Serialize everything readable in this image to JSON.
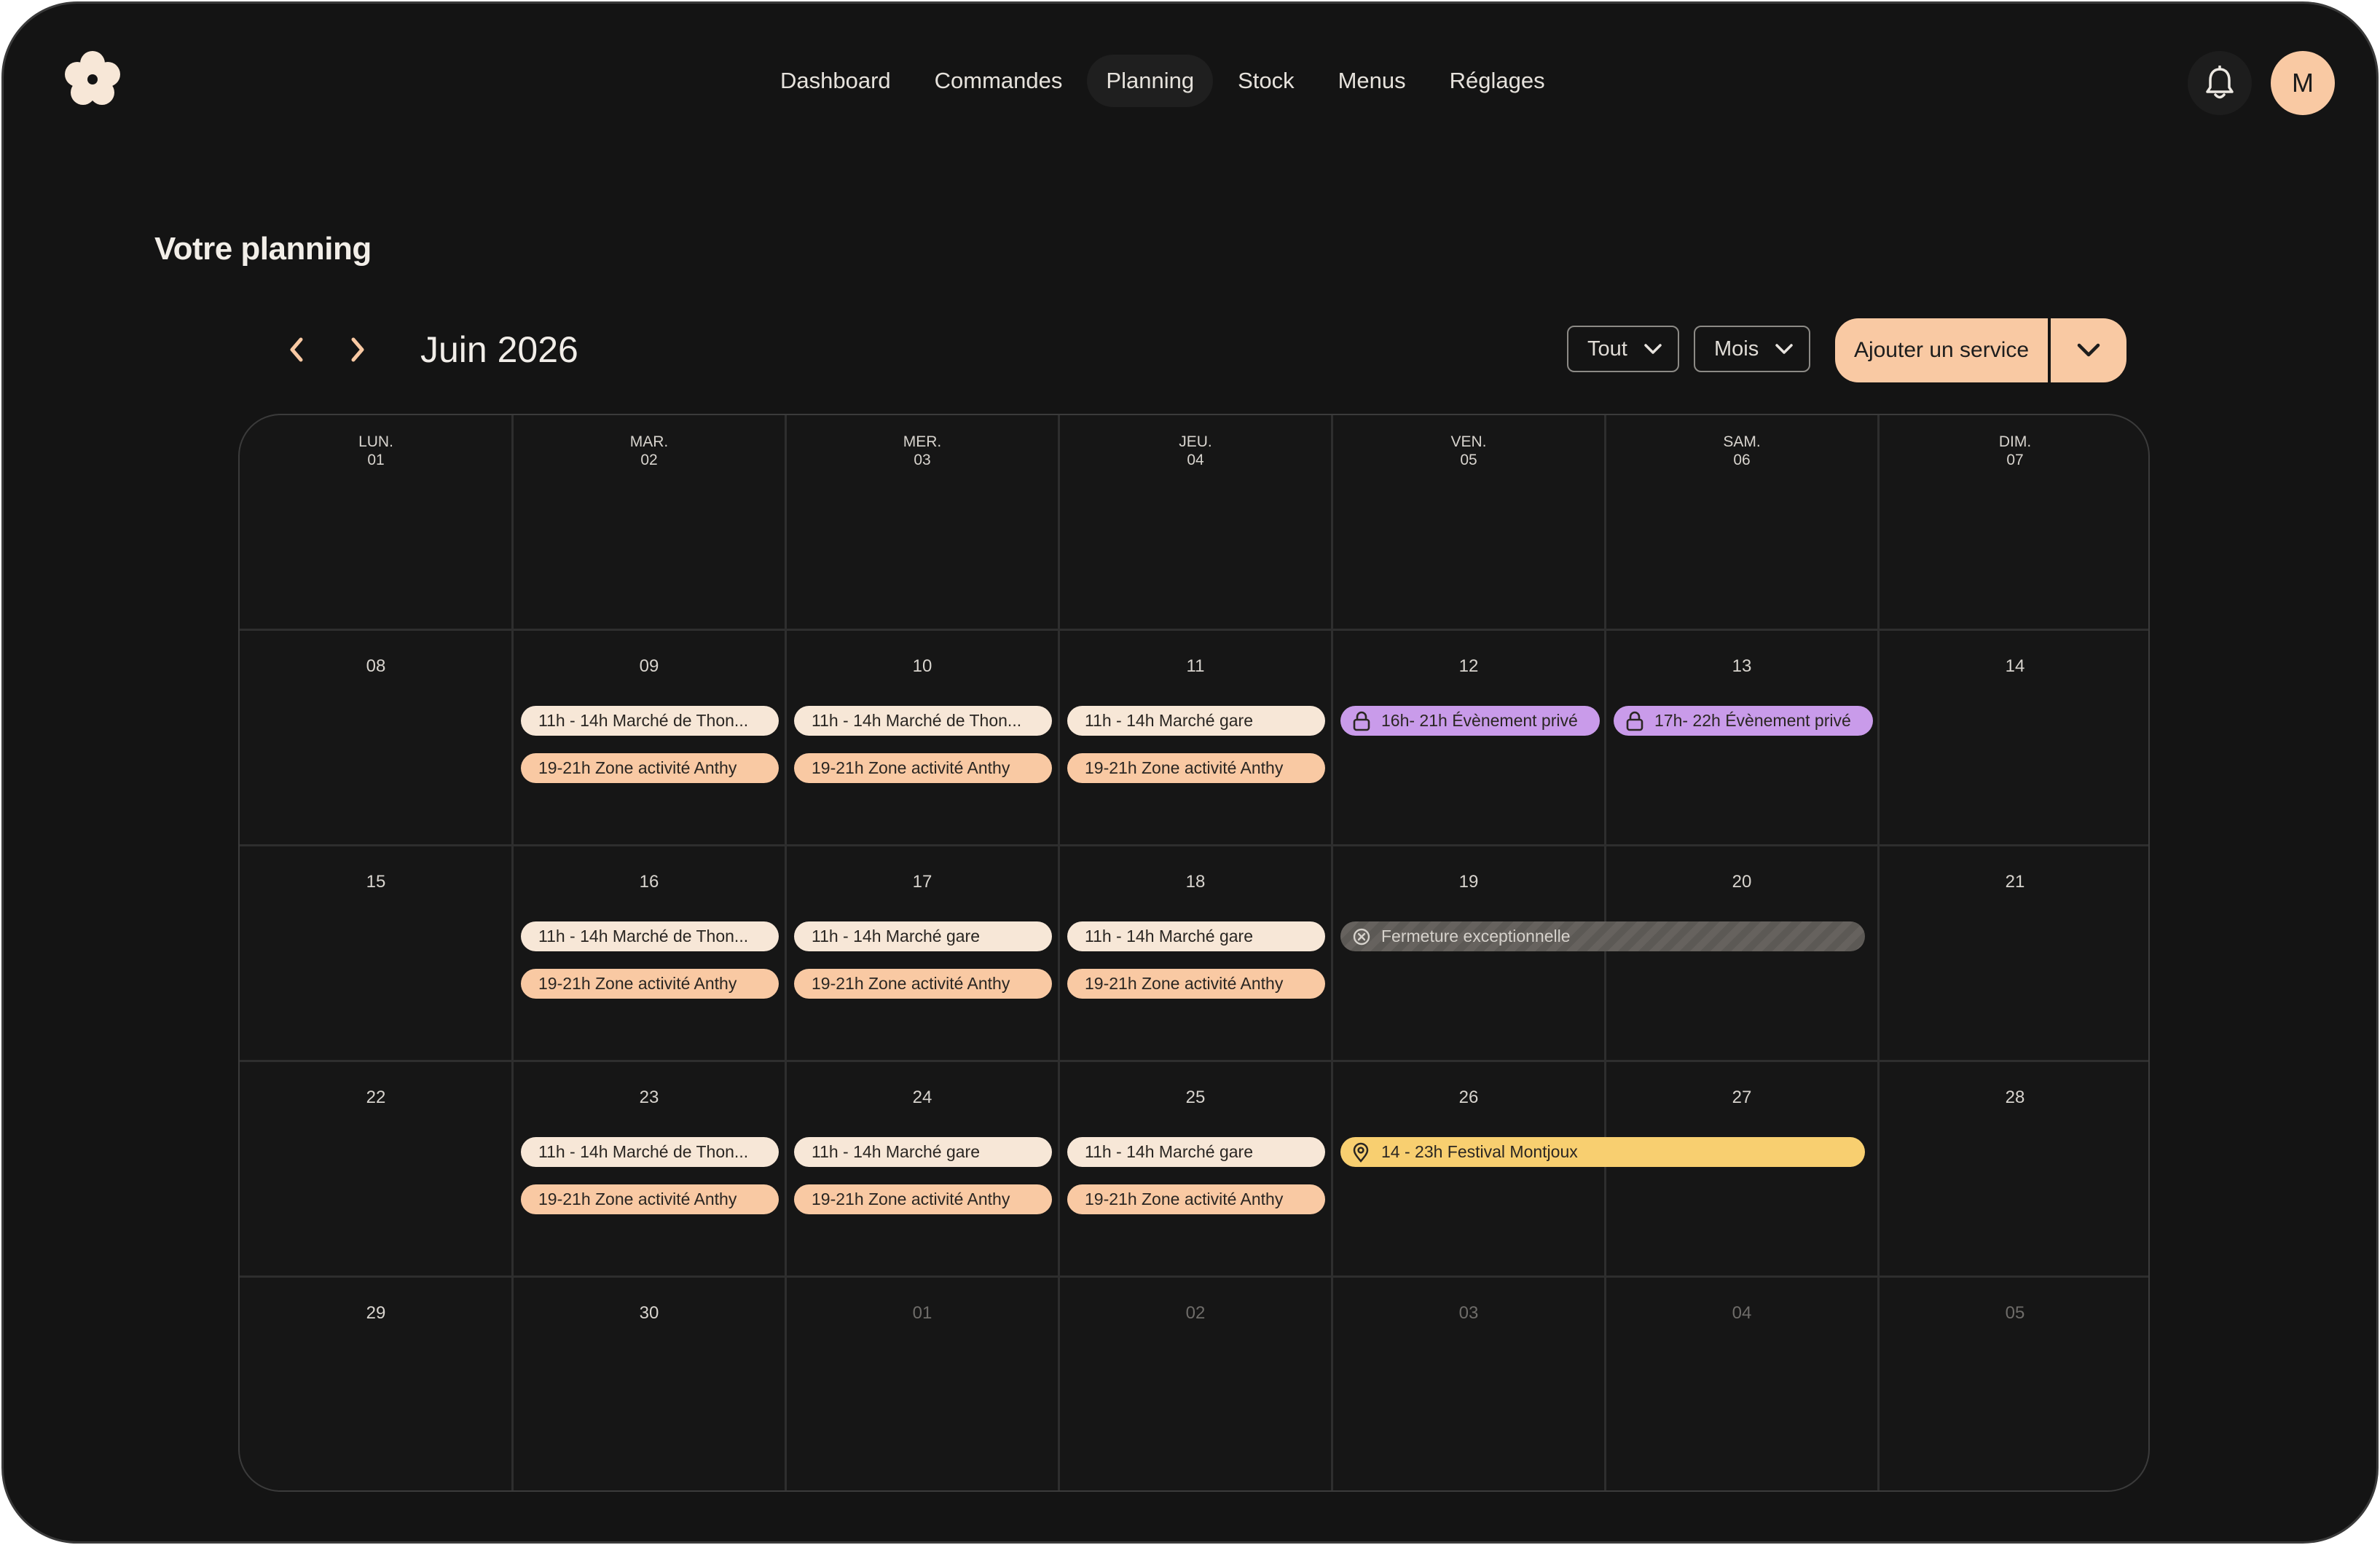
{
  "nav": {
    "items": [
      {
        "label": "Dashboard"
      },
      {
        "label": "Commandes"
      },
      {
        "label": "Planning",
        "active": true
      },
      {
        "label": "Stock"
      },
      {
        "label": "Menus"
      },
      {
        "label": "Réglages"
      }
    ]
  },
  "header": {
    "logo_icon": "flower-icon",
    "notification_icon": "bell-icon",
    "avatar_initial": "M"
  },
  "page": {
    "title": "Votre planning"
  },
  "toolbar": {
    "month": "Juin 2026",
    "filter_value": "Tout",
    "view_value": "Mois",
    "add_label": "Ajouter un service"
  },
  "calendar": {
    "weekdays": [
      {
        "name": "LUN.",
        "num": "01"
      },
      {
        "name": "MAR.",
        "num": "02"
      },
      {
        "name": "MER.",
        "num": "03"
      },
      {
        "name": "JEU.",
        "num": "04"
      },
      {
        "name": "VEN.",
        "num": "05"
      },
      {
        "name": "SAM.",
        "num": "06"
      },
      {
        "name": "DIM.",
        "num": "07"
      }
    ],
    "weeks": [
      [
        "08",
        "09",
        "10",
        "11",
        "12",
        "13",
        "14"
      ],
      [
        "15",
        "16",
        "17",
        "18",
        "19",
        "20",
        "21"
      ],
      [
        "22",
        "23",
        "24",
        "25",
        "26",
        "27",
        "28"
      ],
      [
        "29",
        "30",
        "01",
        "02",
        "03",
        "04",
        "05"
      ]
    ],
    "events": {
      "tue_09_a": "11h - 14h Marché de Thon...",
      "tue_09_b": "19-21h Zone activité Anthy",
      "wed_10_a": "11h - 14h Marché de Thon...",
      "wed_10_b": "19-21h Zone activité Anthy",
      "thu_11_a": "11h - 14h Marché gare",
      "thu_11_b": "19-21h Zone activité Anthy",
      "fri_12": "16h- 21h Évènement privé",
      "sat_13": "17h- 22h Évènement privé",
      "tue_16_a": "11h - 14h Marché de Thon...",
      "tue_16_b": "19-21h Zone activité Anthy",
      "wed_17_a": "11h - 14h Marché gare",
      "wed_17_b": "19-21h Zone activité Anthy",
      "thu_18_a": "11h - 14h Marché gare",
      "thu_18_b": "19-21h Zone activité Anthy",
      "closure": "Fermeture exceptionnelle",
      "tue_23_a": "11h - 14h Marché de Thon...",
      "tue_23_b": "19-21h Zone activité Anthy",
      "wed_24_a": "11h - 14h Marché gare",
      "wed_24_b": "19-21h Zone activité Anthy",
      "thu_25_a": "11h - 14h Marché gare",
      "thu_25_b": "19-21h Zone activité Anthy",
      "festival": "14 - 23h Festival Montjoux"
    }
  },
  "colors": {
    "background": "#141414",
    "accent_peach": "#f9c9a3",
    "event_cream": "#f7e7d7",
    "event_purple": "#c99bea",
    "event_yellow": "#f8cf70",
    "event_closed": "#66625e"
  }
}
